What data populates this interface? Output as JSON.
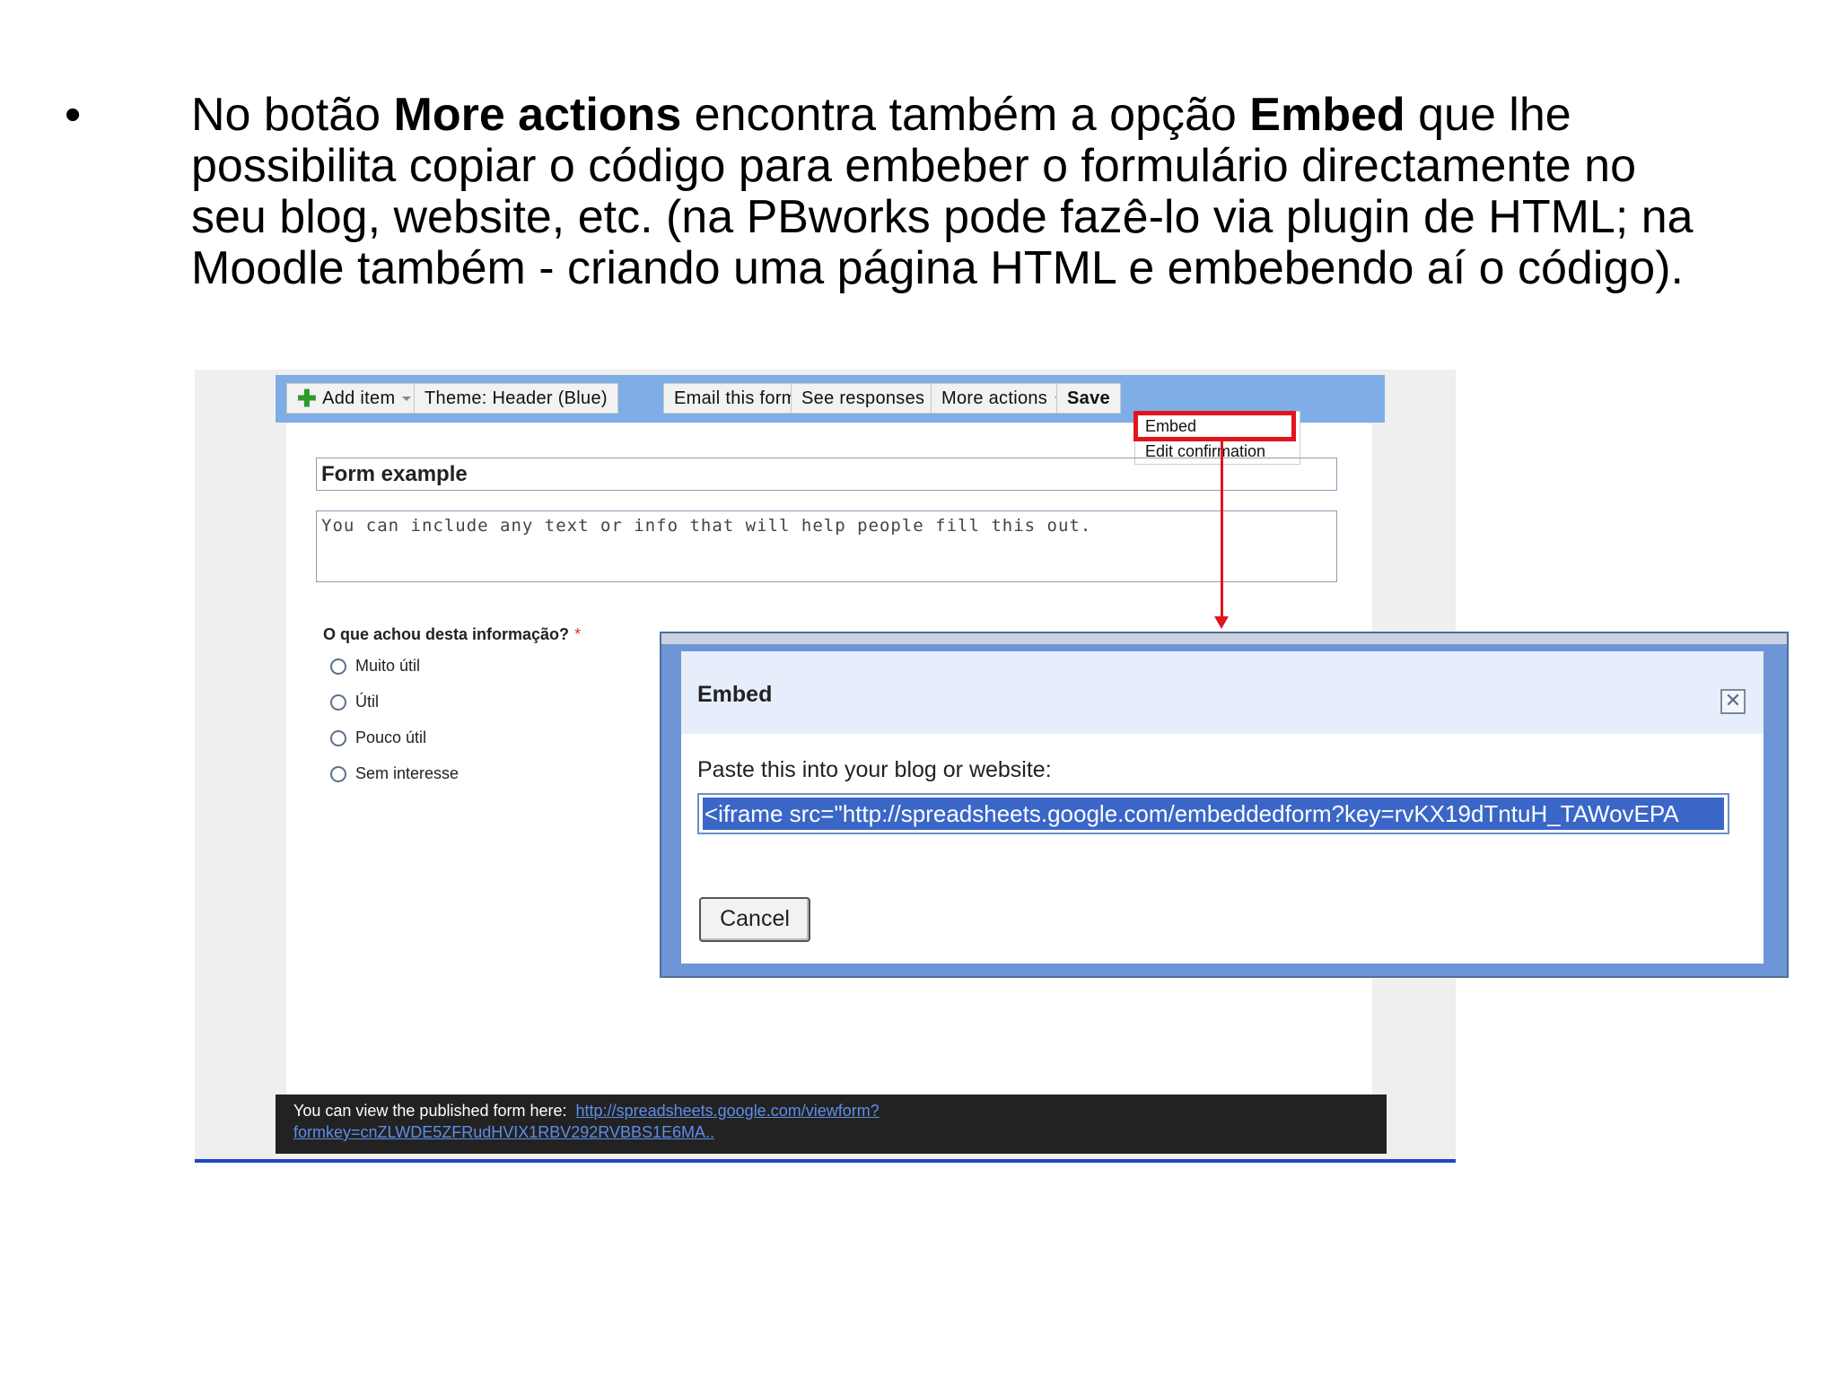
{
  "slide": {
    "bullet": "•",
    "t1": "No botão ",
    "b1": "More actions",
    "t2": " encontra também a opção ",
    "b2": "Embed",
    "t3": " que lhe possibilita copiar o código para embeber o formulário directamente no seu blog, website, etc. (na PBworks pode fazê-lo via plugin de HTML; na Moodle também - criando uma página HTML e embebendo aí o código)."
  },
  "toolbar": {
    "add_item": "Add item",
    "theme": "Theme:  Header (Blue)",
    "email": "Email this form",
    "responses": "See responses",
    "more_actions": "More actions",
    "save": "Save"
  },
  "menu": {
    "embed": "Embed",
    "edit_confirmation": "Edit confirmation"
  },
  "form": {
    "title": "Form example",
    "description": "You can include any text or info that will help people fill this out.",
    "question": "O que achou desta informação?",
    "required_mark": "*",
    "options": [
      "Muito útil",
      "Útil",
      "Pouco útil",
      "Sem interesse"
    ]
  },
  "dialog": {
    "title": "Embed",
    "prompt": "Paste this into your blog or website:",
    "code": "<iframe src=\"http://spreadsheets.google.com/embeddedform?key=rvKX19dTntuH_TAWovEPA",
    "cancel": "Cancel"
  },
  "published": {
    "text": "You can view the published form here:",
    "link1": "http://spreadsheets.google.com/viewform?",
    "link2": "formkey=cnZLWDE5ZFRudHVIX1RBV292RVBBS1E6MA.."
  },
  "colors": {
    "toolbar": "#7eaee5",
    "highlight": "#e3141e",
    "selection": "#3a66c8"
  }
}
